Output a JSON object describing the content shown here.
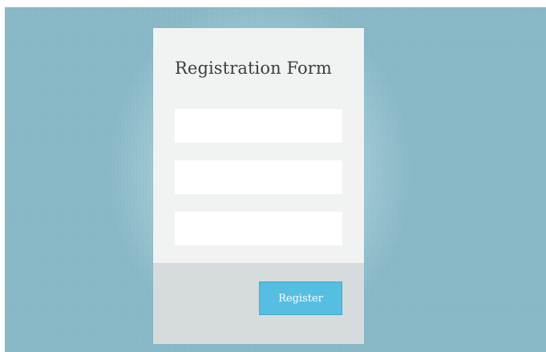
{
  "form": {
    "title": "Registration Form",
    "fields": [
      {
        "value": "",
        "placeholder": ""
      },
      {
        "value": "",
        "placeholder": ""
      },
      {
        "value": "",
        "placeholder": ""
      }
    ],
    "submit_label": "Register"
  },
  "colors": {
    "background": "#88b8c7",
    "card": "#f1f2f2",
    "footer": "#d6dcdd",
    "accent": "#56bee0",
    "title_text": "#3d3d3d"
  }
}
